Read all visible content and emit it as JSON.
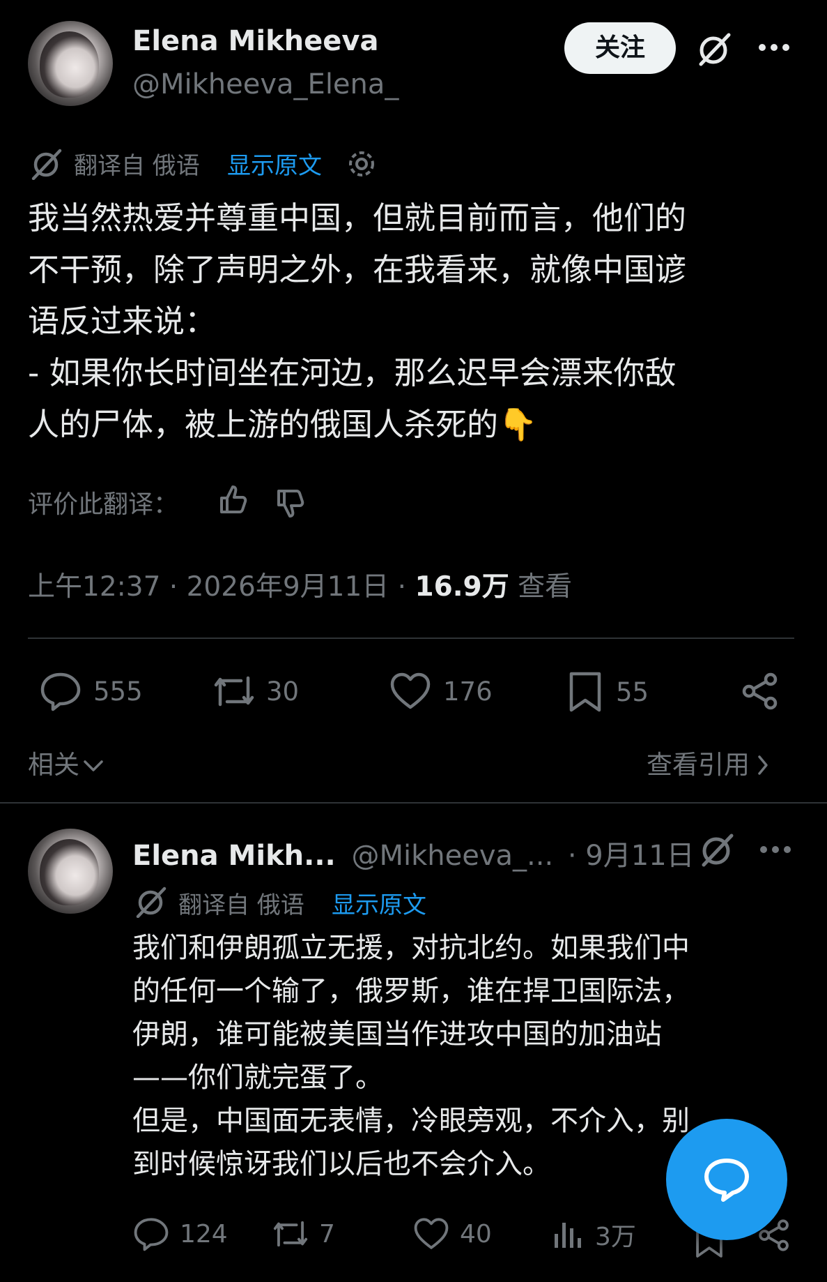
{
  "main_post": {
    "author_name": "Elena Mikheeva",
    "author_handle": "@Mikheeva_Elena_",
    "follow_label": "关注",
    "translate_label": "翻译自 俄语",
    "show_original_label": "显示原文",
    "body_lines": [
      "我当然热爱并尊重中国，但就目前而言，他们的",
      "不干预，除了声明之外，在我看来，就像中国谚",
      "语反过来说：",
      "- 如果你长时间坐在河边，那么迟早会漂来你敌",
      "人的尸体，被上游的俄国人杀死的👇"
    ],
    "rate_label": "评价此翻译：",
    "timestamp": "上午12:37 · 2026年9月11日 · ",
    "views_count": "16.9万",
    "views_label": " 查看",
    "stats": {
      "replies": "555",
      "reposts": "30",
      "likes": "176",
      "bookmarks": "55"
    },
    "related_label": "相关",
    "view_quotes_label": "查看引用"
  },
  "reply_post": {
    "author_name": "Elena Mikh...",
    "author_handle": "@Mikheeva_...",
    "date": "· 9月11日",
    "translate_label": "翻译自 俄语",
    "show_original_label": "显示原文",
    "body_lines": [
      "我们和伊朗孤立无援，对抗北约。如果我们中",
      "的任何一个输了，俄罗斯，谁在捍卫国际法，",
      "伊朗，谁可能被美国当作进攻中国的加油站",
      "——你们就完蛋了。",
      "但是，中国面无表情，冷眼旁观，不介入，别",
      "到时候惊讶我们以后也不会介入。"
    ],
    "stats": {
      "replies": "124",
      "reposts": "7",
      "likes": "40",
      "views": "3万"
    }
  },
  "colors": {
    "background": "#000000",
    "text": "#e7e9ea",
    "muted": "#71767b",
    "accent": "#1d9bf0",
    "divider": "#2f3336"
  },
  "icons": [
    "grok-icon",
    "more-icon",
    "translate-icon",
    "settings-icon",
    "thumbs-up-icon",
    "thumbs-down-icon",
    "reply-icon",
    "repost-icon",
    "like-icon",
    "bookmark-icon",
    "share-icon",
    "chevron-down-icon",
    "chevron-right-icon",
    "views-icon",
    "compose-message-icon"
  ]
}
